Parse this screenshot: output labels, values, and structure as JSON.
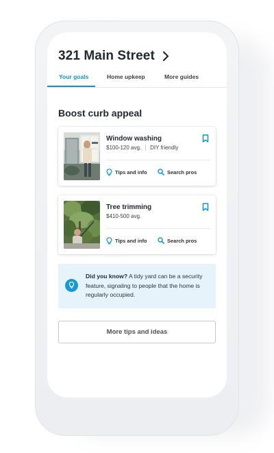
{
  "header": {
    "address": "321 Main Street"
  },
  "tabs": [
    {
      "label": "Your goals",
      "active": true
    },
    {
      "label": "Home upkeep",
      "active": false
    },
    {
      "label": "More guides",
      "active": false
    }
  ],
  "section": {
    "title": "Boost curb appeal"
  },
  "cards": [
    {
      "title": "Window washing",
      "price": "$100-120 avg.",
      "tag": "DIY friendly",
      "actions": {
        "tips": "Tips and info",
        "search": "Search pros"
      },
      "icons": {
        "bookmark": "bookmark-icon",
        "tips": "lightbulb-icon",
        "search": "search-icon"
      }
    },
    {
      "title": "Tree trimming",
      "price": "$410-500 avg.",
      "actions": {
        "tips": "Tips and info",
        "search": "Search pros"
      },
      "icons": {
        "bookmark": "bookmark-icon",
        "tips": "lightbulb-icon",
        "search": "search-icon"
      }
    }
  ],
  "tip": {
    "heading": "Did you know?",
    "body": " A tidy yard can be a security feature, signaling to people that the home is regularly occupied.",
    "icon": "lightbulb-icon"
  },
  "more_button": {
    "label": "More tips and ideas"
  },
  "colors": {
    "accent": "#0f93c8",
    "text": "#222831",
    "tip_background": "#e7f3fb",
    "tip_icon": "#1899d6"
  }
}
